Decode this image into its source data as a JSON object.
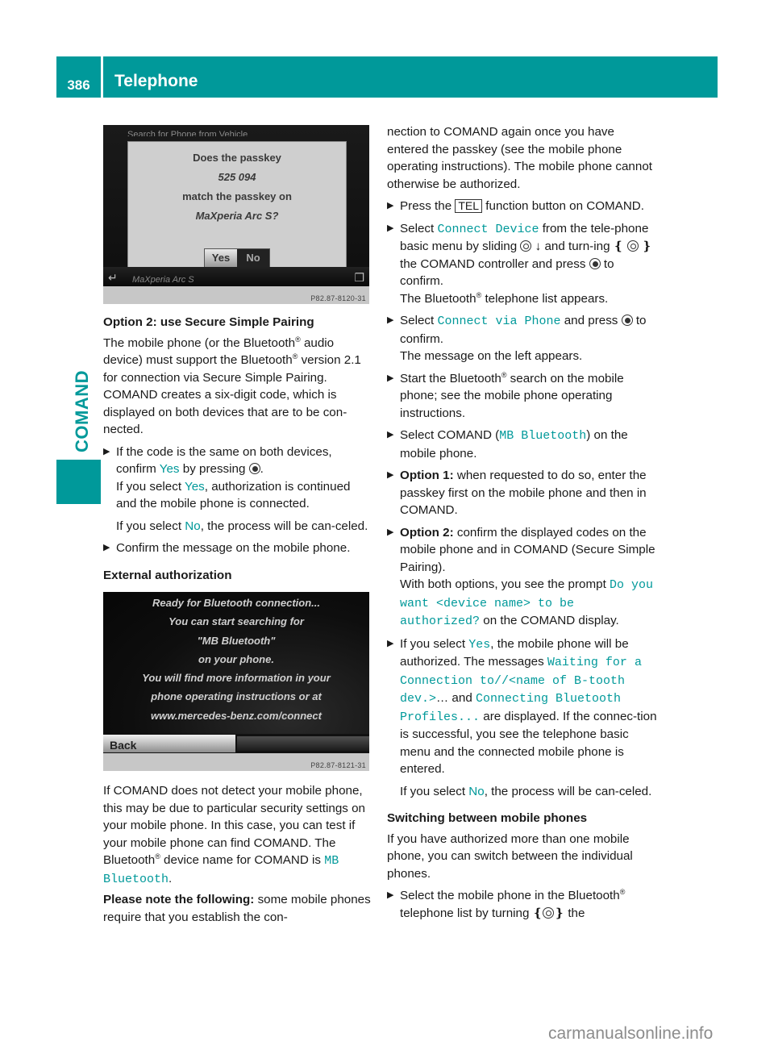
{
  "header": {
    "page_number": "386",
    "title": "Telephone"
  },
  "sidebar": {
    "section_label": "COMAND"
  },
  "screen1": {
    "top_text": "Search for Phone from Vehicle",
    "dialog_lines": [
      "Does the passkey",
      "525 094",
      "match the passkey on",
      "MaXperia Arc S?"
    ],
    "yes_label": "Yes",
    "no_label": "No",
    "device_row": "MaXperia Arc S",
    "back_icon": "back-arrow-icon",
    "menu_icon": "menu-icon",
    "code": "P82.87-8120-31"
  },
  "screen2": {
    "lines": [
      "Ready for Bluetooth connection...",
      "You can start searching for",
      "\"MB Bluetooth\"",
      "on your phone.",
      "You will find more information in your",
      "phone operating instructions or at",
      "www.mercedes-benz.com/connect"
    ],
    "back_label": "Back",
    "code": "P82.87-8121-31"
  },
  "left": {
    "heading1": "Option 2: use Secure Simple Pairing",
    "p1": [
      "The mobile phone (or the Bluetooth",
      "®",
      " audio device) must support the Bluetooth",
      "®",
      " version 2.1 for connection via Secure Simple Pairing. COMAND creates a six-digit code, which is displayed on both devices that are to be con-nected."
    ],
    "b1": {
      "a": "If the code is the same on both devices, confirm ",
      "yes": "Yes",
      "b": " by pressing ",
      "c": "."
    },
    "b1_sub1": {
      "a": "If you select ",
      "yes": "Yes",
      "b": ", authorization is continued and the mobile phone is connected."
    },
    "b1_sub2": {
      "a": "If you select ",
      "no": "No",
      "b": ", the process will be can-celed."
    },
    "b2": "Confirm the message on the mobile phone.",
    "heading2": "External authorization",
    "p2": {
      "a": "If COMAND does not detect your mobile phone, this may be due to particular security settings on your mobile phone. In this case, you can test if your mobile phone can find COMAND. The Bluetooth",
      "reg": "®",
      "b": " device name for COMAND is ",
      "name": "MB Bluetooth",
      "c": "."
    },
    "p3": {
      "bold": "Please note the following:",
      "rest": " some mobile phones require that you establish the con-"
    }
  },
  "right": {
    "p0": "nection to COMAND again once you have entered the passkey (see the mobile phone operating instructions). The mobile phone cannot otherwise be authorized.",
    "b1": {
      "a": "Press the ",
      "key": "TEL",
      "b": " function button on COMAND."
    },
    "b2": {
      "a": "Select ",
      "item": "Connect Device",
      "b": " from the tele-phone basic menu by sliding ",
      "c": " ↓ and turn-ing ❴ ",
      "d": " ❵ the COMAND controller and press ",
      "e": " to confirm."
    },
    "b2_sub": {
      "a": "The Bluetooth",
      "reg": "®",
      "b": " telephone list appears."
    },
    "b3": {
      "a": "Select ",
      "item": "Connect via Phone",
      "b": " and press ",
      "c": " to confirm."
    },
    "b3_sub": "The message on the left appears.",
    "b4": {
      "a": "Start the Bluetooth",
      "reg": "®",
      "b": " search on the mobile phone; see the mobile phone operating instructions."
    },
    "b5": {
      "a": "Select COMAND (",
      "item": "MB Bluetooth",
      "b": ") on the mobile phone."
    },
    "b6": {
      "bold": "Option 1:",
      "rest": " when requested to do so, enter the passkey first on the mobile phone and then in COMAND."
    },
    "b7": {
      "bold": "Option 2:",
      "rest": " confirm the displayed codes on the mobile phone and in COMAND (Secure Simple Pairing)."
    },
    "b7_sub": {
      "a": "With both options, you see the prompt ",
      "item": "Do you want <device name> to be authorized?",
      "b": " on the COMAND display."
    },
    "b8": {
      "a": "If you select ",
      "yes": "Yes",
      "b": ", the mobile phone will be authorized. The messages ",
      "item1": "Waiting for a Connection to//<name of B-tooth dev.>",
      "c": "… and ",
      "item2": "Connecting Bluetooth Profiles...",
      "d": " are displayed. If the connec-tion is successful, you see the telephone basic menu and the connected mobile phone is entered."
    },
    "b8_sub": {
      "a": "If you select ",
      "no": "No",
      "b": ", the process will be can-celed."
    },
    "heading": "Switching between mobile phones",
    "p1": "If you have authorized more than one mobile phone, you can switch between the individual phones.",
    "b9": {
      "a": "Select the mobile phone in the Bluetooth",
      "reg": "®",
      "b": " telephone list by turning ❴",
      "c": "❵ the"
    }
  },
  "watermark": "carmanualsonline.info"
}
